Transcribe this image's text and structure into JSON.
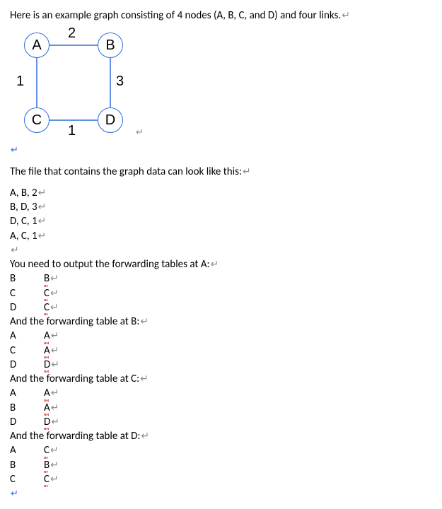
{
  "intro": "Here is an example graph consisting of 4 nodes (A, B, C, and D) and four links.",
  "graph": {
    "nodes": {
      "A": "A",
      "B": "B",
      "C": "C",
      "D": "D"
    },
    "edge_labels": {
      "AB": "2",
      "AC": "1",
      "BD": "3",
      "CD": "1"
    }
  },
  "file_intro": "The file that contains the graph data can look like this:",
  "file_lines": [
    "A, B, 2",
    "B, D, 3",
    "D, C, 1",
    "A, C, 1"
  ],
  "fwd_intro_A": "You need to output the forwarding tables at A:",
  "fwd_A": [
    [
      "B",
      "B"
    ],
    [
      "C",
      "C"
    ],
    [
      "D",
      "C"
    ]
  ],
  "fwd_intro_B": "And the forwarding table at B:",
  "fwd_B": [
    [
      "A",
      "A"
    ],
    [
      "C",
      "A"
    ],
    [
      "D",
      "D"
    ]
  ],
  "fwd_intro_C": "And the forwarding table at C:",
  "fwd_C": [
    [
      "A",
      "A"
    ],
    [
      "B",
      "A"
    ],
    [
      "D",
      "D"
    ]
  ],
  "fwd_intro_D": "And the forwarding table at D:",
  "fwd_D": [
    [
      "A",
      "C"
    ],
    [
      "B",
      "B"
    ],
    [
      "C",
      "C"
    ]
  ],
  "pilcrow": "↵"
}
